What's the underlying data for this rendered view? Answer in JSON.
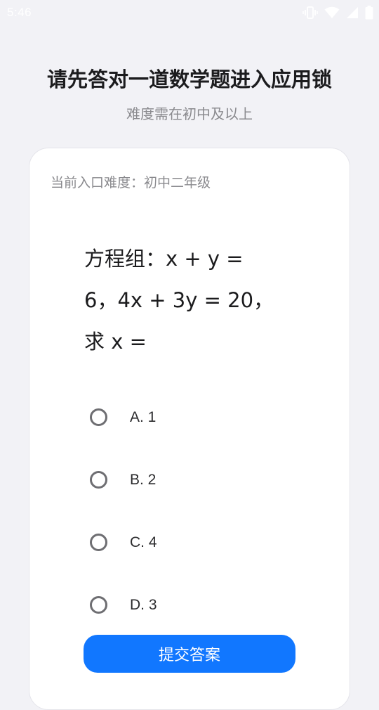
{
  "status_bar": {
    "time": "5:46",
    "icons": [
      "vibrate-icon",
      "wifi-icon",
      "signal-icon",
      "battery-icon"
    ]
  },
  "header": {
    "title": "请先答对一道数学题进入应用锁",
    "subtitle": "难度需在初中及以上"
  },
  "card": {
    "difficulty": "当前入口难度：初中二年级",
    "question_lines": [
      "方程组：x + y =",
      "6，4x + 3y = 20，",
      "求 x ="
    ],
    "options": [
      "A. 1",
      "B. 2",
      "C. 4",
      "D. 3"
    ]
  },
  "submit_label": "提交答案",
  "colors": {
    "background": "#f2f2f6",
    "accent": "#1177ff",
    "card": "#ffffff"
  }
}
